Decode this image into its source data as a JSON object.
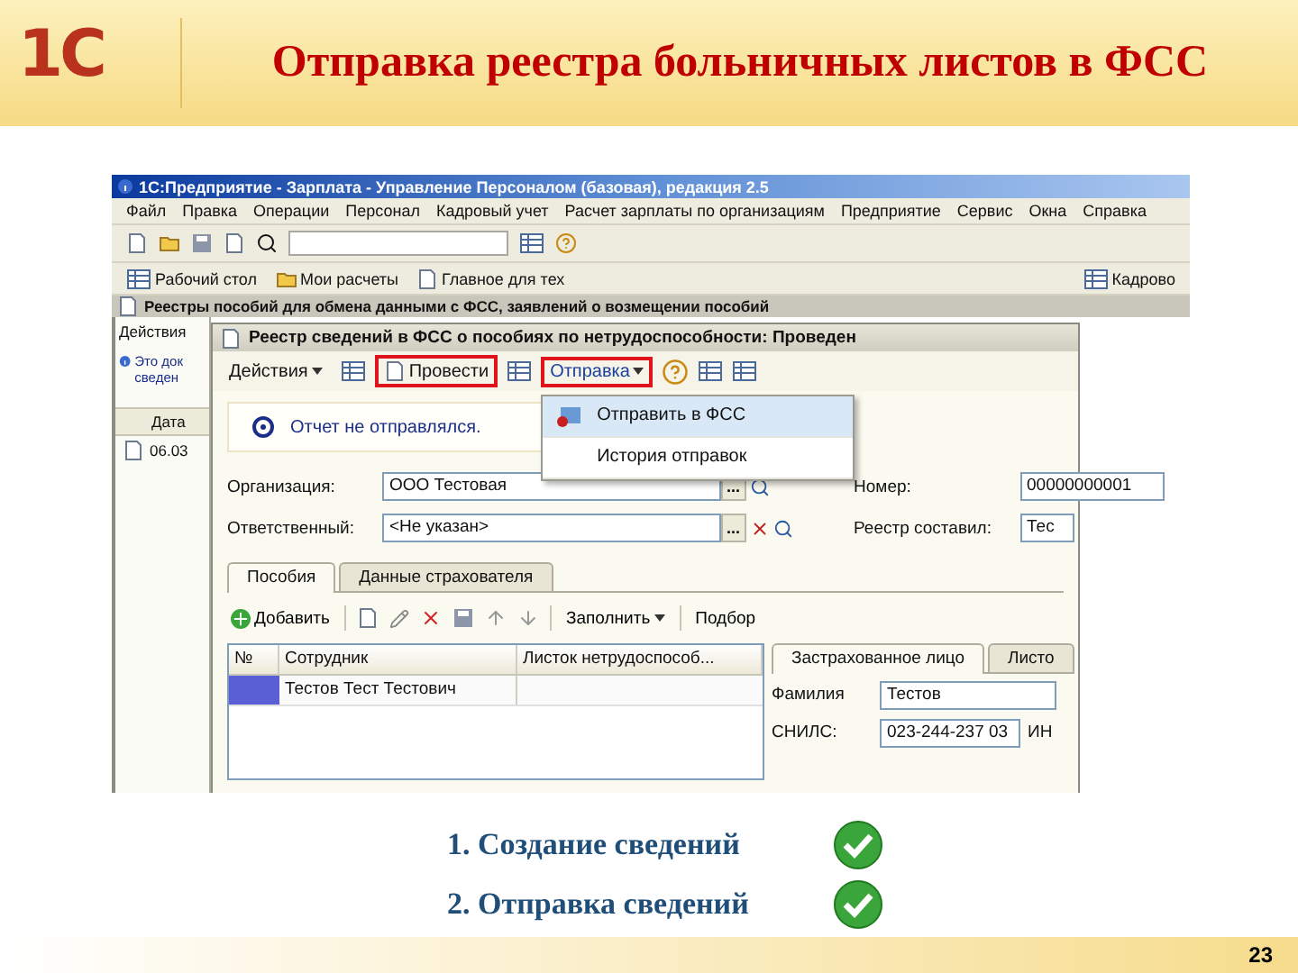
{
  "slide": {
    "logo": "1С",
    "title": "Отправка реестра больничных листов в ФСС",
    "page_number": "23"
  },
  "app": {
    "title": "1С:Предприятие - Зарплата - Управление Персоналом (базовая), редакция 2.5",
    "menu": [
      "Файл",
      "Правка",
      "Операции",
      "Персонал",
      "Кадровый учет",
      "Расчет зарплаты по организациям",
      "Предприятие",
      "Сервис",
      "Окна",
      "Справка"
    ],
    "panel": [
      "Рабочий стол",
      "Мои расчеты",
      "Главное для тех"
    ],
    "panel_right": "Кадрово",
    "window_title": "Реестры пособий для обмена данными с ФСС, заявлений о возмещении пособий",
    "list": {
      "actions": "Действия",
      "info": "Это док сведен",
      "column": "Дата",
      "row": "06.03"
    },
    "form": {
      "title": "Реестр сведений в ФСС о пособиях по нетрудоспособности: Проведен",
      "toolbar": [
        {
          "kind": "menu",
          "label": "Действия",
          "highlighted": false,
          "open": false
        },
        {
          "kind": "icon"
        },
        {
          "kind": "button",
          "label": "Провести",
          "highlighted": true
        },
        {
          "kind": "icon"
        },
        {
          "kind": "menu",
          "label": "Отправка",
          "highlighted": true,
          "open": true,
          "items": [
            {
              "label": "Отправить в ФСС",
              "selected": true
            },
            {
              "label": "История отправок",
              "selected": false
            }
          ]
        },
        {
          "kind": "help"
        },
        {
          "kind": "icon"
        },
        {
          "kind": "icon"
        }
      ],
      "status": "Отчет не отправлялся.",
      "fields_left": [
        {
          "label": "Организация:",
          "value": "ООО Тестовая",
          "button": "...",
          "clear": false
        },
        {
          "label": "Ответственный:",
          "value": "<Не указан>",
          "button": "...",
          "clear": true
        }
      ],
      "fields_right": [
        {
          "label": "Номер:",
          "value": "00000000001"
        },
        {
          "label": "Реестр составил:",
          "value": "Тес"
        }
      ],
      "tabs": [
        {
          "label": "Пособия",
          "selected": true
        },
        {
          "label": "Данные страхователя",
          "selected": false
        }
      ],
      "table_toolbar": {
        "add": "Добавить",
        "fill": "Заполнить",
        "pick": "Подбор"
      },
      "table": {
        "columns": [
          "№",
          "Сотрудник",
          "Листок нетрудоспособ..."
        ],
        "rows": [
          {
            "employee": "Тестов Тест Тестович",
            "selected": true
          }
        ]
      },
      "detail": {
        "tabs": [
          {
            "label": "Застрахованное лицо",
            "selected": true
          },
          {
            "label": "Листо",
            "selected": false
          }
        ],
        "fields": [
          {
            "label": "Фамилия",
            "value": "Тестов"
          },
          {
            "label": "СНИЛС:",
            "value": "023-244-237 03"
          }
        ],
        "cut_label": "ИН"
      }
    }
  },
  "steps": [
    {
      "label": "1. Создание сведений",
      "done": true
    },
    {
      "label": "2. Отправка сведений",
      "done": true
    }
  ]
}
